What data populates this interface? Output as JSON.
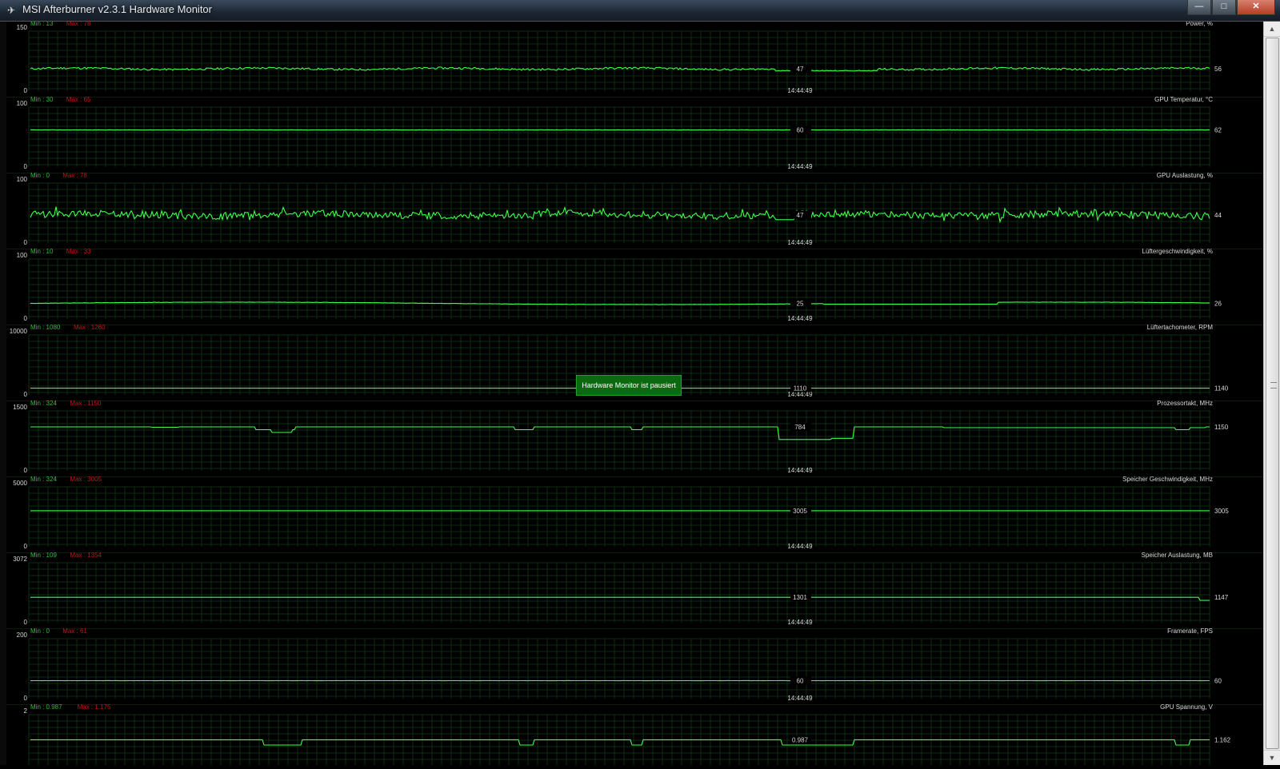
{
  "window": {
    "title": "MSI Afterburner v2.3.1 Hardware Monitor",
    "controls": {
      "minimize": "—",
      "maximize": "□",
      "close": "✕"
    }
  },
  "pause_badge": "Hardware Monitor ist pausiert",
  "colors": {
    "background": "#000000",
    "grid": "#0b2e12",
    "line": "#3cff4a",
    "min_text": "#29c032",
    "max_text": "#c01818",
    "label_text": "#d8d8d8"
  },
  "graphs": [
    {
      "title": "Power, %",
      "y_max": "150",
      "y_min": "0",
      "min_text": "Min : 13",
      "max_text": "Max : 78",
      "scale_max": 150,
      "cursor_value": "47",
      "current_value": "56",
      "time": "14:44:49",
      "line": {
        "base": 56,
        "noise": 2.5,
        "shape": "power"
      }
    },
    {
      "title": "GPU Temperatur, °C",
      "y_max": "100",
      "y_min": "0",
      "min_text": "Min : 30",
      "max_text": "Max : 65",
      "scale_max": 100,
      "cursor_value": "60",
      "current_value": "62",
      "time": "14:44:49",
      "line": {
        "base": 62,
        "noise": 0.3,
        "shape": "flat"
      }
    },
    {
      "title": "GPU Auslastung, %",
      "y_max": "100",
      "y_min": "0",
      "min_text": "Min : 0",
      "max_text": "Max : 78",
      "scale_max": 100,
      "cursor_value": "47",
      "current_value": "44",
      "time": "14:44:49",
      "line": {
        "base": 47,
        "noise": 6,
        "shape": "noisy"
      }
    },
    {
      "title": "Lüftergeschwindigkeit, %",
      "y_max": "100",
      "y_min": "0",
      "min_text": "Min : 10",
      "max_text": "Max : 33",
      "scale_max": 100,
      "cursor_value": "25",
      "current_value": "26",
      "time": "14:44:49",
      "line": {
        "base": 26,
        "noise": 0.5,
        "shape": "wavy"
      }
    },
    {
      "title": "Lüftertachometer, RPM",
      "y_max": "10000",
      "y_min": "0",
      "min_text": "Min : 1080",
      "max_text": "Max : 1260",
      "scale_max": 10000,
      "cursor_value": "1110",
      "current_value": "1140",
      "time": "14:44:49",
      "line": {
        "base": 1120,
        "noise": 0,
        "shape": "flat"
      }
    },
    {
      "title": "Prozessortakt, MHz",
      "y_max": "1500",
      "y_min": "0",
      "min_text": "Min : 324",
      "max_text": "Max : 1150",
      "scale_max": 1500,
      "cursor_value": "784",
      "current_value": "1150",
      "time": "14:44:49",
      "line": {
        "base": 1100,
        "noise": 0,
        "shape": "steps"
      }
    },
    {
      "title": "Speicher Geschwindigkeit, MHz",
      "y_max": "5000",
      "y_min": "0",
      "min_text": "Min : 324",
      "max_text": "Max : 3005",
      "scale_max": 5000,
      "cursor_value": "3005",
      "current_value": "3005",
      "time": "14:44:49",
      "line": {
        "base": 3005,
        "noise": 0,
        "shape": "flat"
      }
    },
    {
      "title": "Speicher Auslastung, MB",
      "y_max": "3072",
      "y_min": "0",
      "min_text": "Min : 109",
      "max_text": "Max : 1354",
      "scale_max": 3072,
      "cursor_value": "1301",
      "current_value": "1147",
      "time": "14:44:49",
      "line": {
        "base": 1301,
        "noise": 0,
        "shape": "drop_end",
        "end_value": 1147
      }
    },
    {
      "title": "Framerate, FPS",
      "y_max": "200",
      "y_min": "0",
      "min_text": "Min : 0",
      "max_text": "Max : 61",
      "scale_max": 200,
      "cursor_value": "60",
      "current_value": "60",
      "time": "14:44:49",
      "line": {
        "base": 60,
        "noise": 0.3,
        "shape": "flat"
      }
    },
    {
      "title": "GPU Spannung, V",
      "y_max": "2",
      "y_min": "0",
      "min_text": "Min : 0.987",
      "max_text": "Max : 1.175",
      "scale_max": 2,
      "cursor_value": "0.987",
      "current_value": "1.162",
      "time": "",
      "line": {
        "base": 1.162,
        "noise": 0,
        "shape": "voltage"
      }
    }
  ]
}
